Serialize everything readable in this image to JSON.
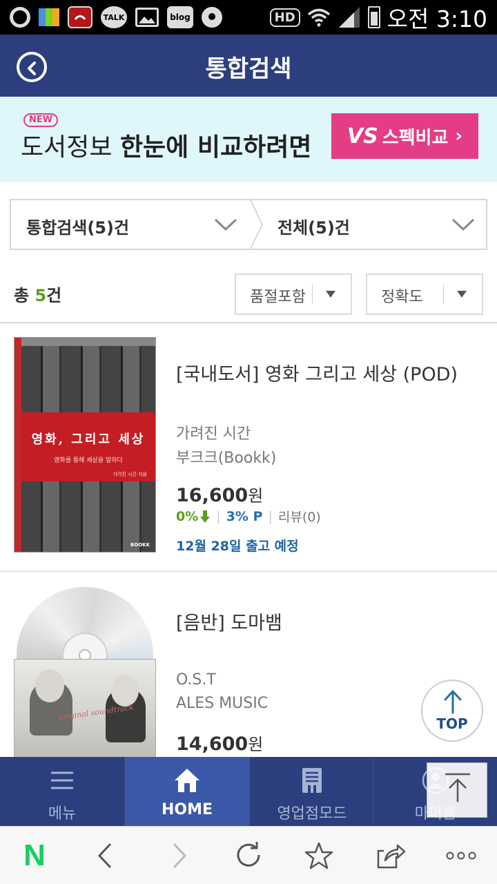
{
  "status_bar": {
    "left_icons": [
      "g-icon",
      "app-grid-icon",
      "call-rec-icon",
      "talk-icon",
      "gallery-icon",
      "blog-icon",
      "settings-icon"
    ],
    "talk_label": "TALK",
    "blog_label": "blog",
    "hd_label": "HD",
    "time": "오전 3:10"
  },
  "header": {
    "title": "통합검색"
  },
  "banner": {
    "new_badge": "NEW",
    "text_plain": "도서정보 ",
    "text_bold": "한눈에 비교하려면",
    "vs_logo": "VS",
    "button_label": "스펙비교",
    "button_chevron": "›"
  },
  "filters": {
    "left_label": "통합검색(5)건",
    "right_label": "전체(5)건"
  },
  "results": {
    "total_prefix": "총 ",
    "total_count": "5",
    "total_suffix": "건",
    "sort1_label": "품절포함",
    "sort2_label": "정확도"
  },
  "items": [
    {
      "title": "[국내도서] 영화 그리고 세상 (POD)",
      "author": "가려진 시간",
      "publisher": "부크크(Bookk)",
      "price": "16,600",
      "price_unit": "원",
      "discount": "0%",
      "points": "3% P",
      "review": "리뷰(0)",
      "shipping": "12월 28일 출고 예정",
      "cover_title": "영화, 그리고 세상",
      "cover_subtitle": "영화를 통해 세상을 말하다",
      "cover_author": "가려진 시간 지음",
      "cover_publisher": "BOOKK"
    },
    {
      "title": "[음반] 도마뱀",
      "author": "O.S.T",
      "publisher": "ALES MUSIC",
      "price": "14,600",
      "price_unit": "원",
      "cover_script": "original soundtrack"
    }
  ],
  "top_button": {
    "label": "TOP"
  },
  "bottom_nav": {
    "items": [
      {
        "label": "메뉴",
        "icon": "menu-icon",
        "active": false
      },
      {
        "label": "HOME",
        "icon": "home-icon",
        "active": true
      },
      {
        "label": "영업점모드",
        "icon": "store-icon",
        "active": false
      },
      {
        "label": "마이룸",
        "icon": "user-icon",
        "active": false
      }
    ]
  },
  "browser_bar": {
    "logo": "N",
    "items": [
      "naver-logo-icon",
      "back-icon",
      "forward-icon",
      "refresh-icon",
      "bookmark-icon",
      "share-icon",
      "more-icon"
    ]
  },
  "colors": {
    "header_bg": "#2d3e7f",
    "banner_bg": "#dff6fa",
    "banner_button": "#e43c85",
    "discount_green": "#5c9e1f",
    "points_blue": "#2a6bb0",
    "ship_blue": "#1d64a8",
    "nav_active": "#3c58a8"
  }
}
